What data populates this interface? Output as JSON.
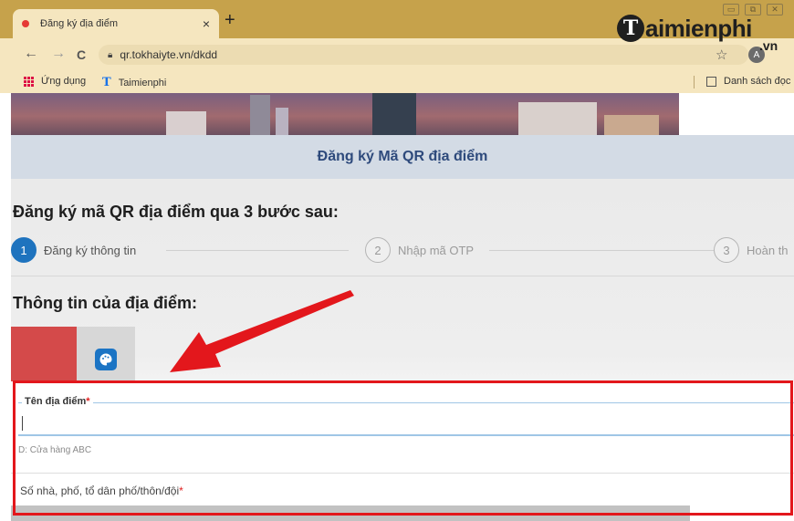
{
  "browser": {
    "tab_title": "Đăng ký địa điểm",
    "tab_close": "×",
    "new_tab": "+",
    "window_controls": [
      "▭",
      "⧉",
      "✕"
    ],
    "back": "←",
    "forward": "→",
    "reload": "C",
    "url": "qr.tokhaiyte.vn/dkdd",
    "avatar_letter": "A",
    "bookmarks": [
      {
        "icon": "apps-icon",
        "label": "Ứng dụng"
      },
      {
        "icon": "taimienphi-icon",
        "label": "Taimienphi"
      }
    ],
    "reading_list": "Danh sách đọc"
  },
  "watermark": {
    "logo_letter": "T",
    "logo_text": "aimienphi",
    "logo_domain": ".vn"
  },
  "page": {
    "header_title": "Đăng ký Mã QR địa điểm",
    "steps_heading": "Đăng ký mã QR địa điểm qua 3 bước sau:",
    "steps": [
      {
        "number": "1",
        "label": "Đăng ký thông tin",
        "active": true
      },
      {
        "number": "2",
        "label": "Nhập mã OTP",
        "active": false
      },
      {
        "number": "3",
        "label": "Hoàn th",
        "active": false
      }
    ],
    "info_heading": "Thông tin của địa điểm:",
    "color_swatch": "#d44a4a",
    "form": {
      "name_label": "Tên địa điểm",
      "required_mark": "*",
      "name_hint": "D: Cửa hàng ABC",
      "address_label": "Số nhà, phố, tổ dân phố/thôn/đội"
    }
  },
  "colors": {
    "tabbar": "#c6a24b",
    "toolbar": "#f5e6bf",
    "header_text": "#2e4a7c",
    "step_active": "#1e73be",
    "highlight": "#e3171c",
    "arrow": "#e3171c"
  }
}
